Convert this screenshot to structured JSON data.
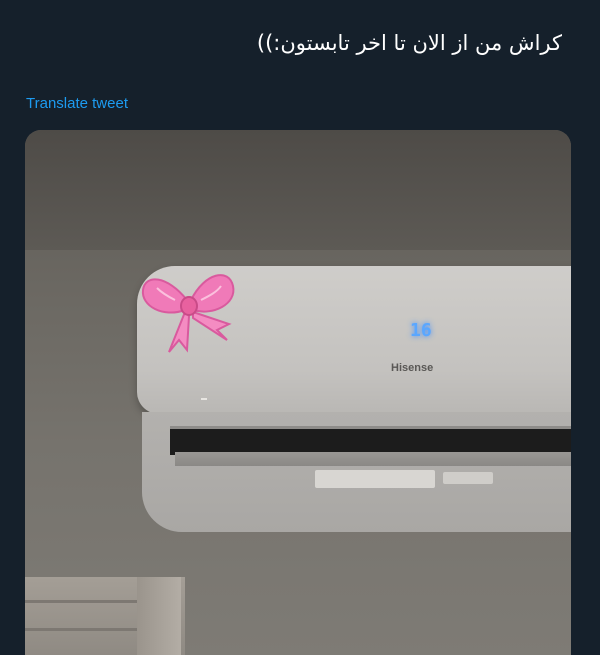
{
  "tweet": {
    "text": "کراش من از الان تا اخر تابستون:))",
    "translate_label": "Translate tweet"
  },
  "media": {
    "ac_display_value": "16",
    "ac_brand": "Hisense"
  },
  "colors": {
    "background": "#15202b",
    "link": "#1d9bf0",
    "bow": "#f07ab8",
    "display": "#5aa7ff"
  },
  "icons": [
    "pink-bow-sticker"
  ]
}
